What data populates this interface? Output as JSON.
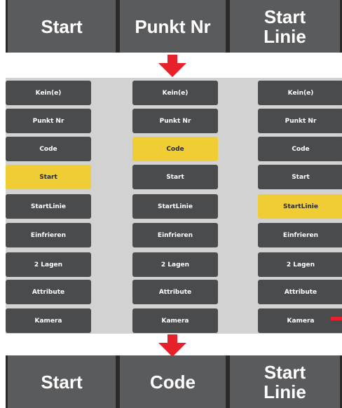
{
  "top_bar": {
    "keys": [
      "Start",
      "Punkt Nr",
      "Start\nLinie"
    ]
  },
  "bottom_bar": {
    "keys": [
      "Start",
      "Code",
      "Start\nLinie"
    ]
  },
  "menu_columns": [
    {
      "items": [
        "Kein(e)",
        "Punkt Nr",
        "Code",
        "Start",
        "StartLinie",
        "Einfrieren",
        "2 Lagen",
        "Attribute",
        "Kamera"
      ],
      "selected": "Start"
    },
    {
      "items": [
        "Kein(e)",
        "Punkt Nr",
        "Code",
        "Start",
        "StartLinie",
        "Einfrieren",
        "2 Lagen",
        "Attribute",
        "Kamera"
      ],
      "selected": "Code"
    },
    {
      "items": [
        "Kein(e)",
        "Punkt Nr",
        "Code",
        "Start",
        "StartLinie",
        "Einfrieren",
        "2 Lagen",
        "Attribute",
        "Kamera"
      ],
      "selected": "StartLinie"
    }
  ],
  "colors": {
    "selected": "#f0cc35",
    "arrow": "#e8202b",
    "key_bg": "#5a5b5d",
    "menu_bg": "#4a4b4d"
  }
}
